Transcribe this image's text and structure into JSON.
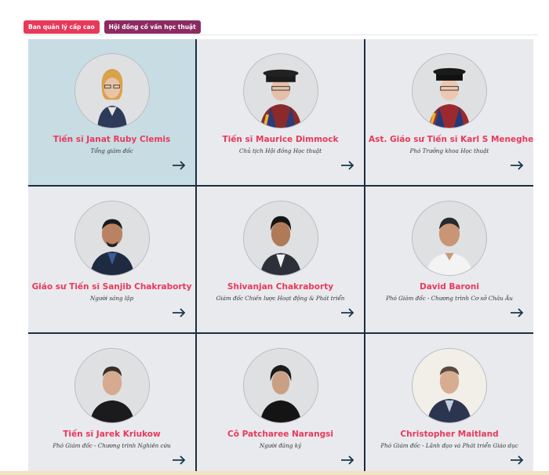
{
  "tabs": [
    {
      "label": "Ban quản lý cấp cao"
    },
    {
      "label": "Hội đồng cố vấn học thuật"
    }
  ],
  "members": [
    {
      "name": "Tiến sĩ Janat Ruby Clemis",
      "role": "Tổng giám đốc"
    },
    {
      "name": "Tiến sĩ Maurice Dimmock",
      "role": "Chủ tịch Hội đồng Học thuật"
    },
    {
      "name": "Ast. Giáo sư Tiến sĩ Karl S Meneghella",
      "role": "Phó Trưởng khoa Học thuật"
    },
    {
      "name": "Giáo sư Tiến sĩ Sanjib Chakraborty",
      "role": "Người sáng lập"
    },
    {
      "name": "Shivanjan Chakraborty",
      "role": "Giám đốc Chiến lược Hoạt động & Phát triển"
    },
    {
      "name": "David Baroni",
      "role": "Phó Giám đốc - Chương trình Cơ sở Châu Âu"
    },
    {
      "name": "Tiến sĩ Jarek Kriukow",
      "role": "Phó Giám đốc - Chương trình Nghiên cứu"
    },
    {
      "name": "Cô Patcharee Narangsi",
      "role": "Người đăng ký"
    },
    {
      "name": "Christopher Maitland",
      "role": "Phó Giám đốc - Lãnh đạo và Phát triển Giáo dục"
    }
  ],
  "colors": {
    "accent": "#e8395b",
    "tab_active": "#8c2a62",
    "grid_line": "#1a3040",
    "card_bg": "#e8eaed",
    "card_active_bg": "#c8dde3"
  },
  "icons": {
    "arrow": "arrow-right-icon",
    "avatar": "avatar-photo"
  }
}
